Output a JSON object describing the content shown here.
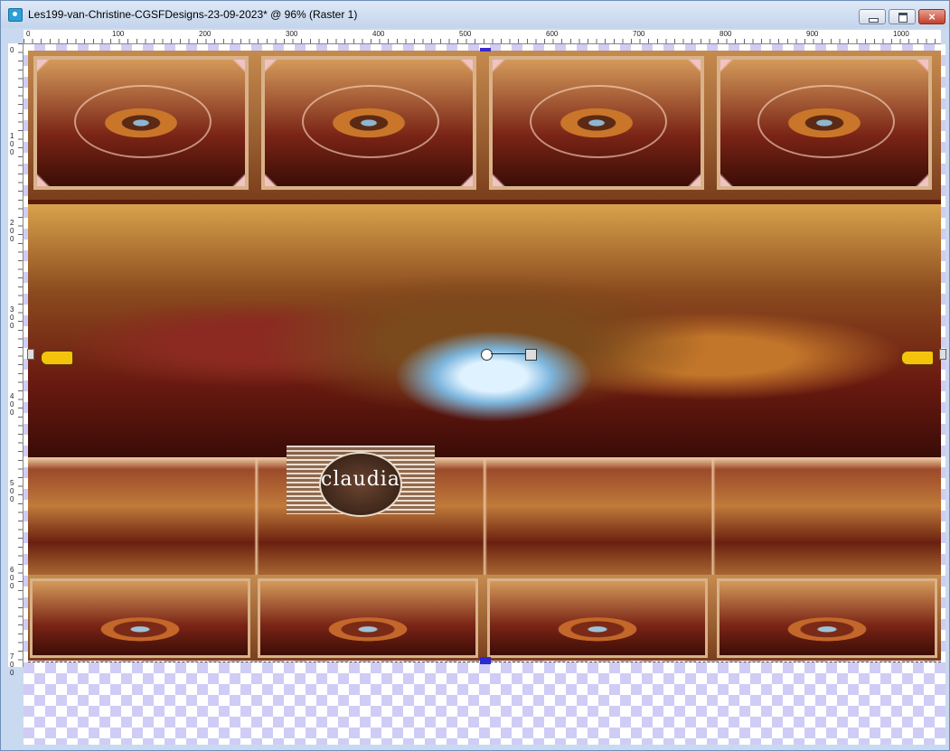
{
  "window": {
    "title": "Les199-van-Christine-CGSFDesigns-23-09-2023* @  96% (Raster 1)",
    "close_label": "×"
  },
  "ruler_top": {
    "labels": [
      "0",
      "100",
      "200",
      "300",
      "400",
      "500",
      "600",
      "700",
      "800",
      "900",
      "1000"
    ]
  },
  "ruler_left": {
    "labels": [
      "0",
      "100",
      "200",
      "300",
      "400",
      "500",
      "600",
      "700"
    ]
  },
  "watermark": {
    "text": "claudia"
  },
  "icons": {
    "app": "paint-shop-icon",
    "pointer_left": "pointing-hand-right-icon",
    "pointer_right": "pointing-hand-left-icon",
    "rotate": "rotate-handle-icon"
  },
  "colors": {
    "titlebar": "#c3d4ec",
    "transparency_checker": "#cfcdf6",
    "close_button": "#c3402c"
  }
}
